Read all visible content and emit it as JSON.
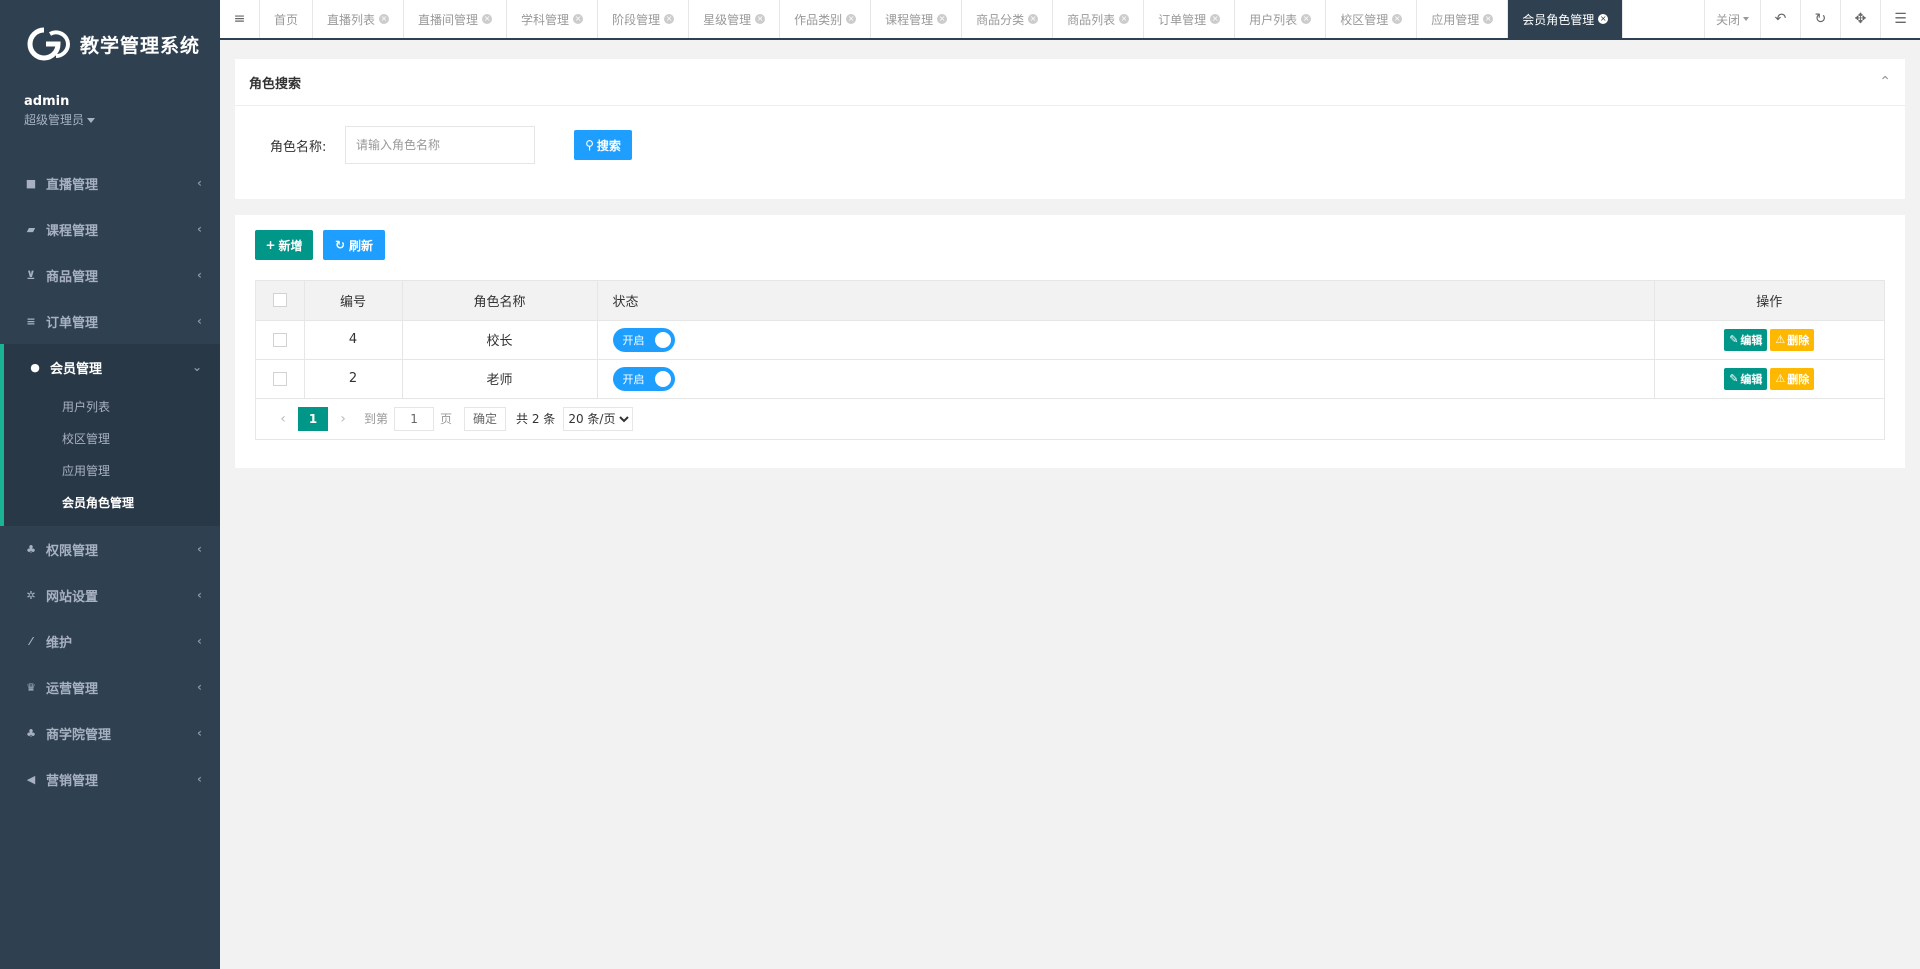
{
  "app": {
    "title": "教学管理系统"
  },
  "colors": {
    "sidebar_bg": "#2f4050",
    "accent": "#009688",
    "primary": "#1e9fff",
    "warning": "#ffb800",
    "active_tab_bg": "#2f4050"
  },
  "user": {
    "name": "admin",
    "role": "超级管理员"
  },
  "sidebar": {
    "items": [
      {
        "label": "直播管理",
        "icon": "video-icon"
      },
      {
        "label": "课程管理",
        "icon": "book-icon"
      },
      {
        "label": "商品管理",
        "icon": "cart-icon"
      },
      {
        "label": "订单管理",
        "icon": "list-icon"
      },
      {
        "label": "会员管理",
        "icon": "user-icon"
      },
      {
        "label": "权限管理",
        "icon": "users-icon"
      },
      {
        "label": "网站设置",
        "icon": "gear-icon"
      },
      {
        "label": "维护",
        "icon": "wand-icon"
      },
      {
        "label": "运营管理",
        "icon": "trophy-icon"
      },
      {
        "label": "商学院管理",
        "icon": "users-icon"
      },
      {
        "label": "营销管理",
        "icon": "bullhorn-icon"
      }
    ],
    "submenu": [
      "用户列表",
      "校区管理",
      "应用管理",
      "会员角色管理"
    ]
  },
  "tabs": [
    "首页",
    "直播列表",
    "直播间管理",
    "学科管理",
    "阶段管理",
    "星级管理",
    "作品类别",
    "课程管理",
    "商品分类",
    "商品列表",
    "订单管理",
    "用户列表",
    "校区管理",
    "应用管理",
    "会员角色管理"
  ],
  "topbar": {
    "close_label": "关闭"
  },
  "search": {
    "title": "角色搜索",
    "field_label": "角色名称:",
    "placeholder": "请输入角色名称",
    "button_label": "搜索"
  },
  "toolbar": {
    "add_label": "新增",
    "refresh_label": "刷新"
  },
  "table": {
    "columns": [
      "编号",
      "角色名称",
      "状态",
      "操作"
    ],
    "rows": [
      {
        "id": "4",
        "name": "校长",
        "status": "开启"
      },
      {
        "id": "2",
        "name": "老师",
        "status": "开启"
      }
    ],
    "edit_label": "编辑",
    "delete_label": "删除"
  },
  "pagination": {
    "current": "1",
    "goto_label": "到第",
    "page_input": "1",
    "page_unit": "页",
    "confirm_label": "确定",
    "total": "共 2 条",
    "page_size": "20 条/页"
  }
}
